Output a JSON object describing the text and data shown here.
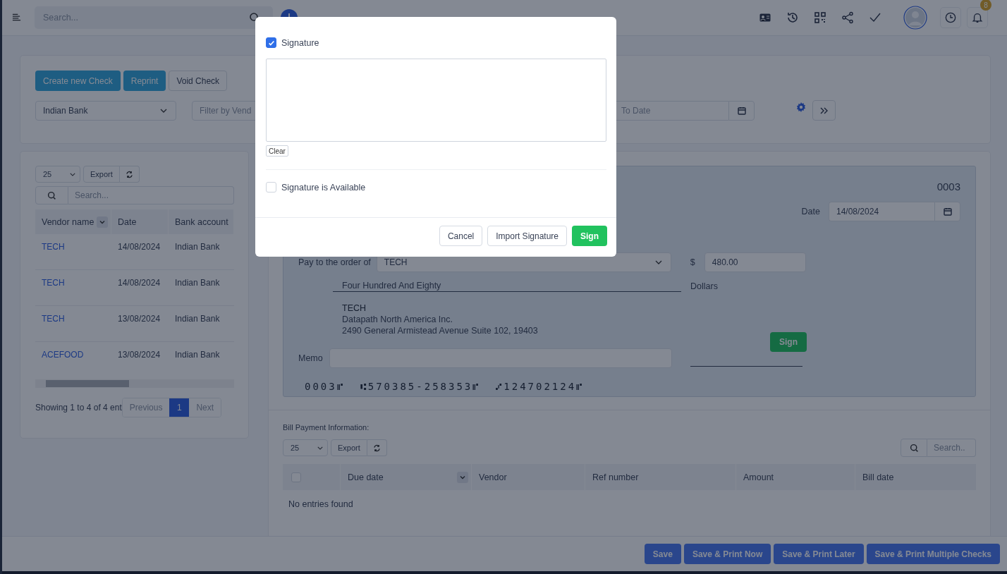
{
  "topbar": {
    "search_placeholder": "Search...",
    "notification_count": "8"
  },
  "filters": {
    "buttons": [
      {
        "label": "Create new Check",
        "kind": "primary"
      },
      {
        "label": "Reprint",
        "kind": "primary"
      },
      {
        "label": "Void Check",
        "kind": "outline"
      }
    ],
    "bank": "Indian Bank",
    "vendor_placeholder": "Filter by Vend",
    "to_date_placeholder": "To Date"
  },
  "checks_list": {
    "page_size": "25",
    "export": "Export",
    "search_placeholder": "Search...",
    "columns": [
      "Vendor name",
      "Date",
      "Bank account"
    ],
    "rows": [
      {
        "vendor": "TECH",
        "date": "14/08/2024",
        "bank": "Indian Bank"
      },
      {
        "vendor": "TECH",
        "date": "14/08/2024",
        "bank": "Indian Bank"
      },
      {
        "vendor": "TECH",
        "date": "13/08/2024",
        "bank": "Indian Bank"
      },
      {
        "vendor": "ACEFOOD",
        "date": "13/08/2024",
        "bank": "Indian Bank"
      }
    ],
    "info": "Showing 1 to 4 of 4 ent",
    "pages": [
      {
        "label": "Previous",
        "selected": false
      },
      {
        "label": "1",
        "selected": true
      },
      {
        "label": "Next",
        "selected": false
      }
    ]
  },
  "check": {
    "number": "0003",
    "date_label": "Date",
    "date": "14/08/2024",
    "pay_label": "Pay to the order of",
    "payee": "TECH",
    "currency": "$",
    "amount": "480.00",
    "amount_words": "Four Hundred And Eighty",
    "dollars_label": "Dollars",
    "address": [
      "TECH",
      "Datapath North America Inc.",
      "2490 General Armistead Avenue Suite 102, 19403"
    ],
    "sign": "Sign",
    "memo_label": "Memo",
    "micr": [
      "0003⑈",
      "⑆570385-258353⑈",
      "⑇124702124⑈"
    ]
  },
  "bill_payment": {
    "title": "Bill Payment Information:",
    "page_size": "25",
    "export": "Export",
    "search_placeholder": "Search..",
    "select_all_checked": false,
    "columns": [
      "Due date",
      "Vendor",
      "Ref number",
      "Amount",
      "Bill date"
    ],
    "empty": "No entries found"
  },
  "footer_buttons": [
    "Save",
    "Save & Print Now",
    "Save & Print Later",
    "Save & Print Multiple Checks"
  ],
  "modal": {
    "signature_checked": true,
    "signature_label": "Signature",
    "clear": "Clear",
    "available_checked": false,
    "available_label": "Signature is Available",
    "buttons": [
      {
        "label": "Cancel",
        "kind": "outline"
      },
      {
        "label": "Import Signature",
        "kind": "outline"
      },
      {
        "label": "Sign",
        "kind": "success"
      }
    ]
  }
}
